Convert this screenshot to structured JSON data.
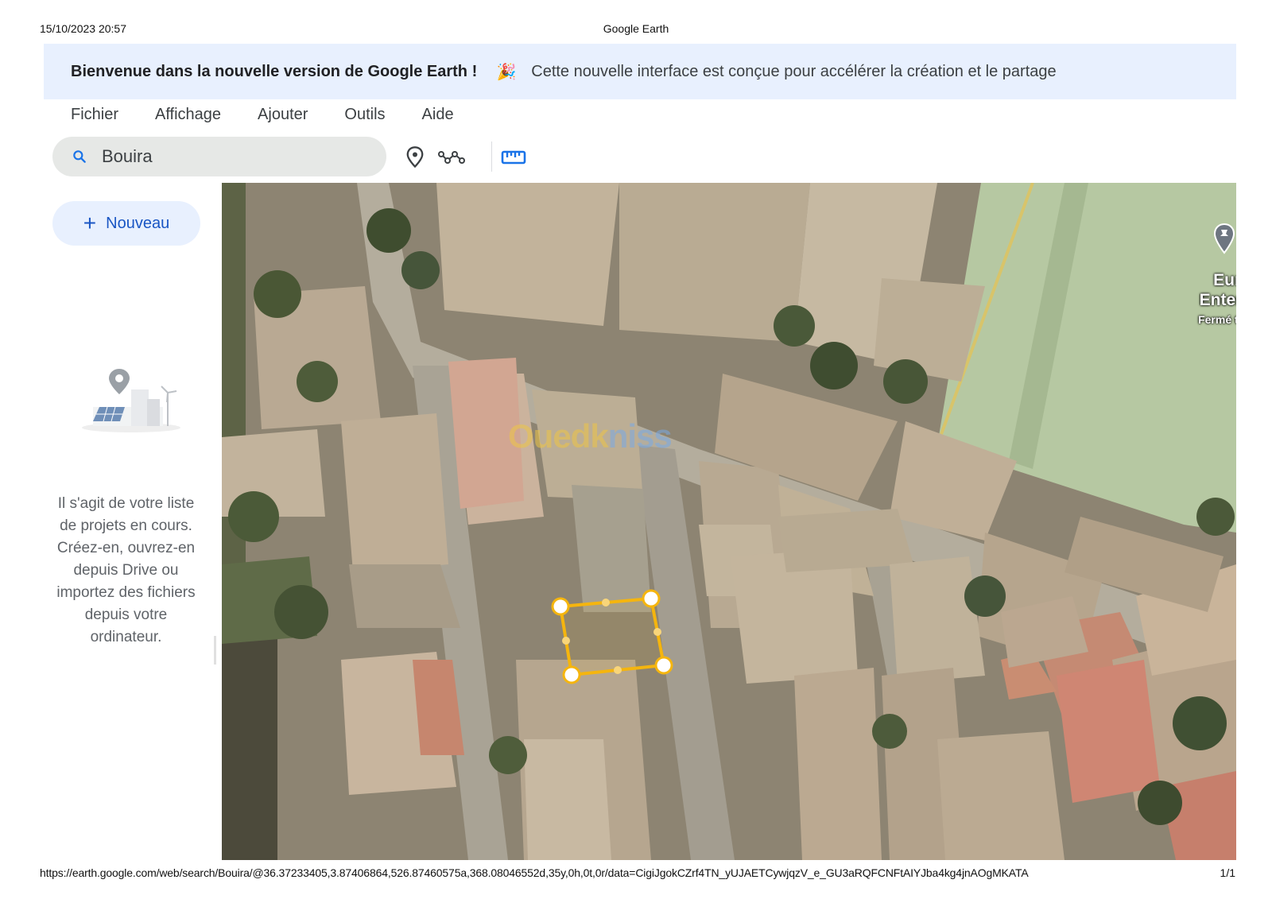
{
  "print": {
    "datetime": "15/10/2023 20:57",
    "page_title": "Google Earth",
    "url": "https://earth.google.com/web/search/Bouira/@36.37233405,3.87406864,526.87460575a,368.08046552d,35y,0h,0t,0r/data=CigiJgokCZrf4TN_yUJAETCywjqzV_e_GU3aRQFCNFtAIYJba4kg4jnAOgMKATA",
    "page_number": "1/1"
  },
  "banner": {
    "title": "Bienvenue dans la nouvelle version de Google Earth !",
    "emoji": "🎉",
    "message": "Cette nouvelle interface est conçue pour accélérer la création et le partage"
  },
  "menu": [
    "Fichier",
    "Affichage",
    "Ajouter",
    "Outils",
    "Aide"
  ],
  "search": {
    "value": "Bouira",
    "icon": "search-icon"
  },
  "toolbar": {
    "icons": [
      "add-placemark-icon",
      "draw-path-icon",
      "measure-ruler-icon"
    ],
    "active_color": "#1a73e8"
  },
  "sidebar": {
    "new_button": {
      "icon": "+",
      "label": "Nouveau"
    },
    "empty_message": "Il s'agit de votre liste de projets en cours. Créez-en, ouvrez-en depuis Drive ou importez des fichiers depuis votre ordinateur."
  },
  "map": {
    "watermark": {
      "part1": "Ouedk",
      "part2": "niss"
    },
    "place_label": {
      "line1": "Eurl Gl",
      "line2": "Entertair",
      "line3": "Fermé tempo"
    },
    "polygon_color": "#f5b50e"
  }
}
